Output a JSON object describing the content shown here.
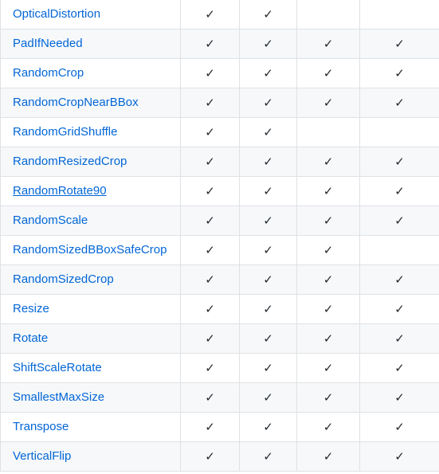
{
  "check_glyph": "✓",
  "rows": [
    {
      "name": "OpticalDistortion",
      "checks": [
        true,
        true,
        false,
        false
      ]
    },
    {
      "name": "PadIfNeeded",
      "checks": [
        true,
        true,
        true,
        true
      ]
    },
    {
      "name": "RandomCrop",
      "checks": [
        true,
        true,
        true,
        true
      ]
    },
    {
      "name": "RandomCropNearBBox",
      "checks": [
        true,
        true,
        true,
        true
      ]
    },
    {
      "name": "RandomGridShuffle",
      "checks": [
        true,
        true,
        false,
        false
      ]
    },
    {
      "name": "RandomResizedCrop",
      "checks": [
        true,
        true,
        true,
        true
      ]
    },
    {
      "name": "RandomRotate90",
      "checks": [
        true,
        true,
        true,
        true
      ],
      "underlined": true
    },
    {
      "name": "RandomScale",
      "checks": [
        true,
        true,
        true,
        true
      ]
    },
    {
      "name": "RandomSizedBBoxSafeCrop",
      "checks": [
        true,
        true,
        true,
        false
      ]
    },
    {
      "name": "RandomSizedCrop",
      "checks": [
        true,
        true,
        true,
        true
      ]
    },
    {
      "name": "Resize",
      "checks": [
        true,
        true,
        true,
        true
      ]
    },
    {
      "name": "Rotate",
      "checks": [
        true,
        true,
        true,
        true
      ]
    },
    {
      "name": "ShiftScaleRotate",
      "checks": [
        true,
        true,
        true,
        true
      ]
    },
    {
      "name": "SmallestMaxSize",
      "checks": [
        true,
        true,
        true,
        true
      ]
    },
    {
      "name": "Transpose",
      "checks": [
        true,
        true,
        true,
        true
      ]
    },
    {
      "name": "VerticalFlip",
      "checks": [
        true,
        true,
        true,
        true
      ]
    }
  ],
  "colors": {
    "link": "#0366d6",
    "text": "#24292e",
    "border": "#dfe2e5",
    "stripe": "#f6f8fa"
  }
}
